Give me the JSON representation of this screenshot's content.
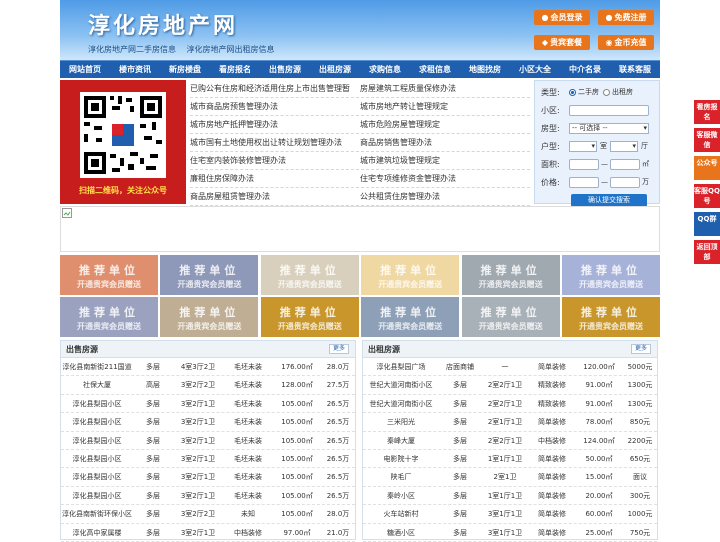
{
  "header": {
    "logo": "淳化房地产网",
    "links": [
      "淳化房地产网二手房信息",
      "淳化房地产网出租房信息"
    ],
    "buttons": [
      {
        "label": "会员登录",
        "icon": "user-icon"
      },
      {
        "label": "免费注册",
        "icon": "user-add-icon"
      },
      {
        "label": "贵宾套餐",
        "icon": "crown-icon"
      },
      {
        "label": "金币充值",
        "icon": "coin-icon"
      }
    ]
  },
  "nav": [
    "网站首页",
    "楼市资讯",
    "新房楼盘",
    "看房报名",
    "出售房源",
    "出租房源",
    "求购信息",
    "求租信息",
    "地图找房",
    "小区大全",
    "中介名录",
    "联系客服"
  ],
  "qr": {
    "caption": "扫描二维码，关注公众号"
  },
  "links": [
    [
      "已购公有住房和经济适用住房上市出售管理暂",
      "房屋建筑工程质量保修办法"
    ],
    [
      "城市商品房预售管理办法",
      "城市房地产转让管理规定"
    ],
    [
      "城市房地产抵押管理办法",
      "城市危险房屋管理规定"
    ],
    [
      "城市国有土地使用权出让转让规划管理办法",
      "商品房销售管理办法"
    ],
    [
      "住宅室内装饰装修管理办法",
      "城市建筑垃圾管理规定"
    ],
    [
      "廉租住房保障办法",
      "住宅专项维修资金管理办法"
    ],
    [
      "商品房屋租赁管理办法",
      "公共租赁住房管理办法"
    ]
  ],
  "search": {
    "type_label": "类型:",
    "type_options": [
      "二手房",
      "出租房"
    ],
    "community_label": "小区:",
    "house_type_label": "房型:",
    "house_type_value": "-- 可选择 --",
    "layout_label": "户型:",
    "room_unit": "室",
    "hall_unit": "厅",
    "area_label": "面积:",
    "area_sep": "—",
    "area_unit": "㎡",
    "price_label": "价格:",
    "price_sep": "—",
    "price_unit": "万",
    "submit": "确认提交搜索"
  },
  "ads": {
    "title": "推荐单位",
    "subtitle": "开通贵宾会员赠送",
    "colors": [
      "#e08f6e",
      "#8e98b8",
      "#d8d0bc",
      "#f0d8a3",
      "#a0a8b0",
      "#a7b2d8",
      "#9aa2c0",
      "#bfae94",
      "#c8962a",
      "#8ea0b8",
      "#a8b0b8",
      "#c8962a"
    ]
  },
  "sale": {
    "title": "出售房源",
    "more": "更多",
    "rows": [
      [
        "淳化县南新街211国道",
        "多层",
        "4室3厅2卫",
        "毛坯未装",
        "176.00㎡",
        "28.0万"
      ],
      [
        "社保大厦",
        "高层",
        "3室2厅2卫",
        "毛坯未装",
        "128.00㎡",
        "27.5万"
      ],
      [
        "淳化县梨园小区",
        "多层",
        "3室2厅1卫",
        "毛坯未装",
        "105.00㎡",
        "26.5万"
      ],
      [
        "淳化县梨园小区",
        "多层",
        "3室2厅1卫",
        "毛坯未装",
        "105.00㎡",
        "26.5万"
      ],
      [
        "淳化县梨园小区",
        "多层",
        "3室2厅1卫",
        "毛坯未装",
        "105.00㎡",
        "26.5万"
      ],
      [
        "淳化县梨园小区",
        "多层",
        "3室2厅1卫",
        "毛坯未装",
        "105.00㎡",
        "26.5万"
      ],
      [
        "淳化县梨园小区",
        "多层",
        "3室2厅1卫",
        "毛坯未装",
        "105.00㎡",
        "26.5万"
      ],
      [
        "淳化县梨园小区",
        "多层",
        "3室2厅1卫",
        "毛坯未装",
        "105.00㎡",
        "26.5万"
      ],
      [
        "淳化县南新街环保小区",
        "多层",
        "3室2厅2卫",
        "未知",
        "105.00㎡",
        "28.0万"
      ],
      [
        "淳化高中家属楼",
        "多层",
        "3室2厅1卫",
        "中档装修",
        "97.00㎡",
        "21.0万"
      ]
    ]
  },
  "rent": {
    "title": "出租房源",
    "more": "更多",
    "rows": [
      [
        "淳化县梨园广场",
        "店面商铺",
        "一",
        "简单装修",
        "120.00㎡",
        "5000元"
      ],
      [
        "世纪大道河南街小区",
        "多层",
        "2室2厅1卫",
        "精致装修",
        "91.00㎡",
        "1300元"
      ],
      [
        "世纪大道河南街小区",
        "多层",
        "2室2厅1卫",
        "精致装修",
        "91.00㎡",
        "1300元"
      ],
      [
        "三米阳光",
        "多层",
        "2室1厅1卫",
        "简单装修",
        "78.00㎡",
        "850元"
      ],
      [
        "秦峰大厦",
        "多层",
        "2室2厅1卫",
        "中档装修",
        "124.00㎡",
        "2200元"
      ],
      [
        "电影院十字",
        "多层",
        "1室1厅1卫",
        "简单装修",
        "50.00㎡",
        "650元"
      ],
      [
        "陕毛厂",
        "多层",
        "2室1卫",
        "简单装修",
        "15.00㎡",
        "面议"
      ],
      [
        "秦岭小区",
        "多层",
        "1室1厅1卫",
        "简单装修",
        "20.00㎡",
        "300元"
      ],
      [
        "火车站新村",
        "多层",
        "3室1厅1卫",
        "简单装修",
        "60.00㎡",
        "1000元"
      ],
      [
        "糖酒小区",
        "多层",
        "3室1厅1卫",
        "简单装修",
        "25.00㎡",
        "750元"
      ]
    ]
  },
  "sidebar": [
    {
      "label": "看房报名",
      "color": "#d9222a"
    },
    {
      "label": "客服微信",
      "color": "#d9222a"
    },
    {
      "label": "公众号",
      "color": "#e8751b"
    },
    {
      "label": "客服QQ号",
      "color": "#d9222a"
    },
    {
      "label": "QQ群",
      "color": "#1f5fae"
    },
    {
      "label": "返回顶部",
      "color": "#d9222a"
    }
  ]
}
